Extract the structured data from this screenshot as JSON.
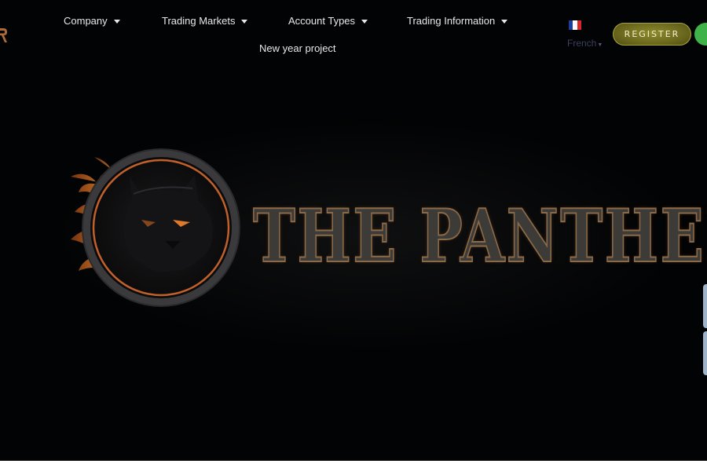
{
  "nav": {
    "items": [
      {
        "label": "Company"
      },
      {
        "label": "Trading Markets"
      },
      {
        "label": "Account Types"
      },
      {
        "label": "Trading Information"
      }
    ],
    "second_row": "New year project"
  },
  "language": {
    "label": "French",
    "flag": "french-flag-icon"
  },
  "register": {
    "label": "REGISTER"
  },
  "hero": {
    "brand": "THE PANTHER",
    "emblem": "panther-head-emblem"
  },
  "colors": {
    "background": "#020304",
    "register_button": "#7a7722",
    "green_button": "#3fb24a",
    "nav_text": "#e8e8e8"
  }
}
